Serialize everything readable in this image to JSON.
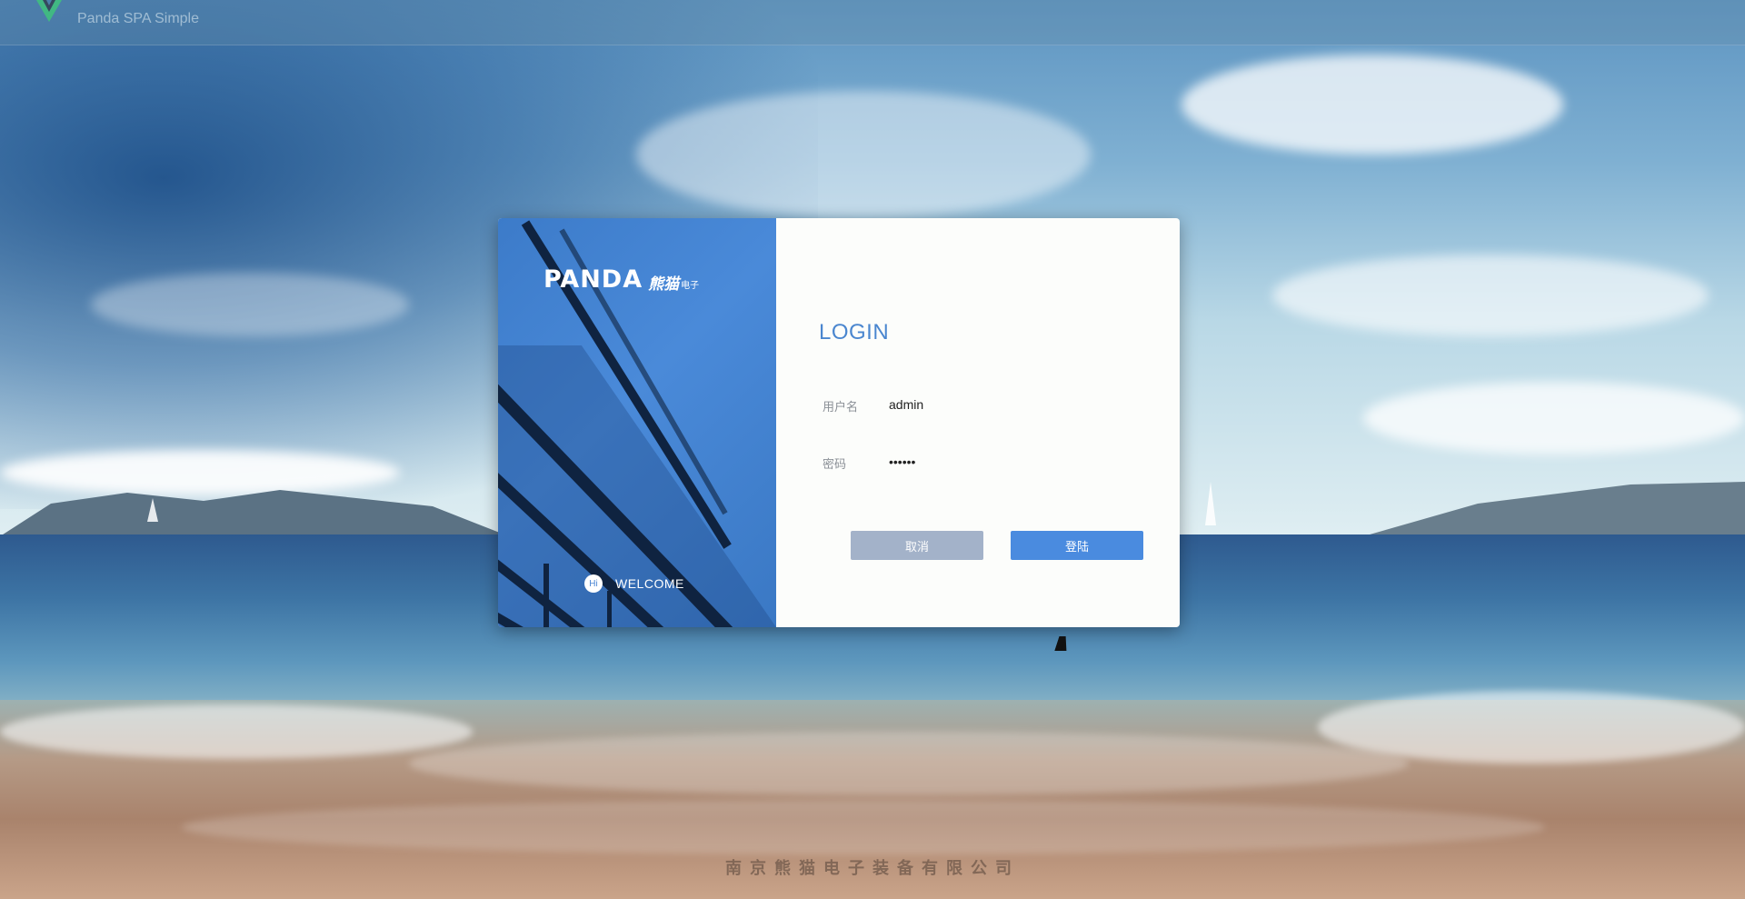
{
  "header": {
    "title": "Panda SPA Simple",
    "logo_icon": "vue-logo-icon"
  },
  "card": {
    "brand": {
      "word": "PANDA",
      "chinese_main": "熊猫",
      "chinese_sub": "电子"
    },
    "hi_badge": "Hi",
    "welcome": "WELCOME",
    "login_title": "LOGIN",
    "username_label": "用户名",
    "username_value": "admin",
    "password_label": "密码",
    "password_value": "••••••",
    "cancel_label": "取消",
    "login_label": "登陆"
  },
  "footer": {
    "company": "南京熊猫电子装备有限公司"
  },
  "colors": {
    "accent": "#4a8bdf",
    "title_blue": "#4a86cf",
    "cancel_gray": "#a3b2c9",
    "card_bg": "#fcfdfb"
  }
}
